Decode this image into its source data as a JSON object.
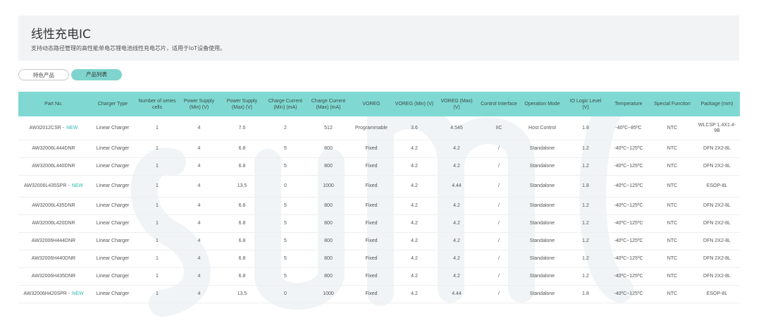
{
  "header": {
    "title": "线性充电IC",
    "subtitle": "支持动态路径管理的高性能单电芯锂电池线性充电芯片，适用于IoT设备使用。"
  },
  "tabs": [
    {
      "label": "特色产品",
      "active": false
    },
    {
      "label": "产品列表",
      "active": true
    }
  ],
  "table": {
    "columns": [
      "Part No.",
      "Charger Type",
      "Number of series cells",
      "Power Supply (Min) (V)",
      "Power Supply (Max) (V)",
      "Charge Current (Min) (mA)",
      "Charge Current (Max) (mA)",
      "VOREG",
      "VOREG (Min) (V)",
      "VOREG (Max) (V)",
      "Control Interface",
      "Operation Mode",
      "IO Logic Level (V)",
      "Temperature",
      "Special Function",
      "Package (mm)"
    ],
    "new_badge": "NEW",
    "rows": [
      {
        "part": "AW32012CSR",
        "isnew": true,
        "cells": [
          "Linear Charger",
          "1",
          "4",
          "7.5",
          "2",
          "512",
          "Programmable",
          "3.6",
          "4.545",
          "IIC",
          "Host Control",
          "1.8",
          "-40ºC~85ºC",
          "NTC",
          "WLCSP 1.4X1.4-9B"
        ]
      },
      {
        "part": "AW32006L444DNR",
        "isnew": false,
        "cells": [
          "Linear Charger",
          "1",
          "4",
          "6.8",
          "5",
          "800",
          "Fixed",
          "4.2",
          "4.2",
          "/",
          "Standalone",
          "1.2",
          "-40ºC~125ºC",
          "NTC",
          "DFN 2X2-8L"
        ]
      },
      {
        "part": "AW32006L440DNR",
        "isnew": false,
        "cells": [
          "Linear Charger",
          "1",
          "4",
          "6.8",
          "5",
          "800",
          "Fixed",
          "4.2",
          "4.2",
          "/",
          "Standalone",
          "1.2",
          "-40ºC~125ºC",
          "NTC",
          "DFN 2X2-8L"
        ]
      },
      {
        "part": "AW32006L435SPR",
        "isnew": true,
        "cells": [
          "Linear Charger",
          "1",
          "4",
          "13.5",
          "0",
          "1000",
          "Fixed",
          "4.2",
          "4.44",
          "/",
          "Standalone",
          "1.8",
          "-40ºC~125ºC",
          "NTC",
          "ESOP-8L"
        ]
      },
      {
        "part": "AW32006L435DNR",
        "isnew": false,
        "cells": [
          "Linear Charger",
          "1",
          "4",
          "6.8",
          "5",
          "800",
          "Fixed",
          "4.2",
          "4.2",
          "/",
          "Standalone",
          "1.2",
          "-40ºC~125ºC",
          "NTC",
          "DFN 2X2-8L"
        ]
      },
      {
        "part": "AW32006L420DNR",
        "isnew": false,
        "cells": [
          "Linear Charger",
          "1",
          "4",
          "6.8",
          "5",
          "800",
          "Fixed",
          "4.2",
          "4.2",
          "/",
          "Standalone",
          "1.2",
          "-40ºC~125ºC",
          "NTC",
          "DFN 2X2-8L"
        ]
      },
      {
        "part": "AW32006H444DNR",
        "isnew": false,
        "cells": [
          "Linear Charger",
          "1",
          "4",
          "6.8",
          "5",
          "800",
          "Fixed",
          "4.2",
          "4.2",
          "/",
          "Standalone",
          "1.2",
          "-40ºC~125ºC",
          "NTC",
          "DFN 2X2-8L"
        ]
      },
      {
        "part": "AW32006H440DNR",
        "isnew": false,
        "cells": [
          "Linear Charger",
          "1",
          "4",
          "6.8",
          "5",
          "800",
          "Fixed",
          "4.2",
          "4.2",
          "/",
          "Standalone",
          "1.2",
          "-40ºC~125ºC",
          "NTC",
          "DFN 2X2-8L"
        ]
      },
      {
        "part": "AW32006H435DNR",
        "isnew": false,
        "cells": [
          "Linear Charger",
          "1",
          "4",
          "6.8",
          "5",
          "800",
          "Fixed",
          "4.2",
          "4.2",
          "/",
          "Standalone",
          "1.2",
          "-40ºC~125ºC",
          "NTC",
          "DFN 2X2-8L"
        ]
      },
      {
        "part": "AW32006H420SPR",
        "isnew": true,
        "cells": [
          "Linear Charger",
          "1",
          "4",
          "13.5",
          "0",
          "1000",
          "Fixed",
          "4.2",
          "4.44",
          "/",
          "Standalone",
          "1.8",
          "-40ºC~125ºC",
          "NTC",
          "ESOP-8L"
        ]
      }
    ]
  },
  "colors": {
    "accent": "#7fd9d2",
    "new_badge": "#6fcfc6",
    "header_bg": "#f2f3f4"
  }
}
